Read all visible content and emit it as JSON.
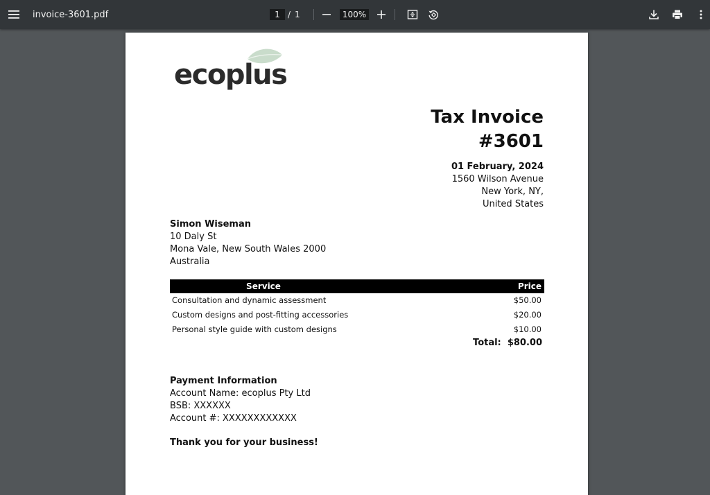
{
  "toolbar": {
    "title": "invoice-3601.pdf",
    "page_current": "1",
    "page_separator": "/",
    "page_total": "1",
    "zoom": "100%"
  },
  "logo": {
    "text": "ecoplus",
    "leaf_color": "#c9dccb"
  },
  "invoice": {
    "title": "Tax Invoice",
    "number": "#3601",
    "date": "01 February, 2024",
    "from_address": [
      "1560 Wilson Avenue",
      "New York, NY,",
      "United States"
    ]
  },
  "bill_to": {
    "name": "Simon Wiseman",
    "lines": [
      "10 Daly St",
      "Mona Vale, New South Wales 2000",
      "Australia"
    ]
  },
  "table": {
    "headers": {
      "service": "Service",
      "price": "Price"
    },
    "rows": [
      {
        "service": "Consultation and dynamic assessment",
        "price": "$50.00"
      },
      {
        "service": "Custom designs and post-fitting accessories",
        "price": "$20.00"
      },
      {
        "service": "Personal style guide with custom designs",
        "price": "$10.00"
      }
    ],
    "total_label": "Total:",
    "total_value": "$80.00"
  },
  "payment": {
    "heading": "Payment Information",
    "account_name": "Account Name: ecoplus Pty Ltd",
    "bsb": "BSB: XXXXXX",
    "account_number": "Account #: XXXXXXXXXXXX"
  },
  "thanks": "Thank you for your business!"
}
